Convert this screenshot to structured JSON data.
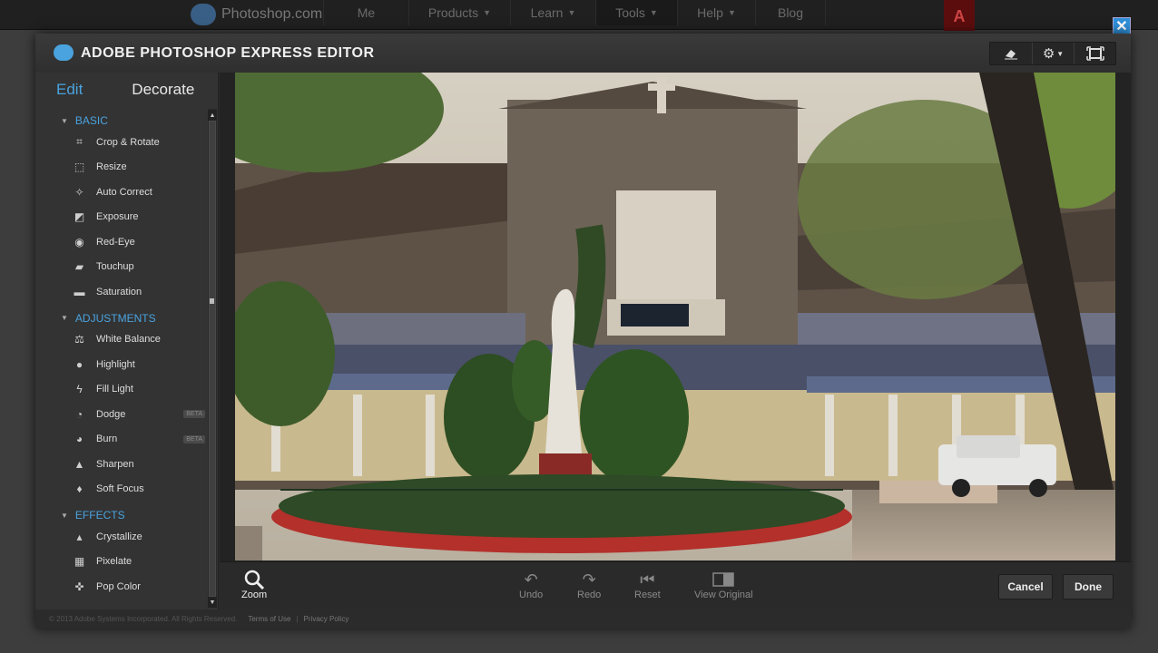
{
  "site_nav": {
    "brand": "Photoshop.com",
    "items": [
      {
        "label": "Me",
        "caret": false
      },
      {
        "label": "Products",
        "caret": true
      },
      {
        "label": "Learn",
        "caret": true
      },
      {
        "label": "Tools",
        "caret": true
      },
      {
        "label": "Help",
        "caret": true
      },
      {
        "label": "Blog",
        "caret": false
      }
    ],
    "adobe_logo": "A"
  },
  "editor": {
    "title": "ADOBE PHOTOSHOP EXPRESS EDITOR",
    "close": "✕",
    "toolbar_icons": [
      "eraser-icon",
      "gear-icon",
      "fullscreen-icon"
    ]
  },
  "sidebar": {
    "tabs": {
      "edit": "Edit",
      "decorate": "Decorate"
    },
    "sections": [
      {
        "title": "BASIC",
        "tools": [
          {
            "label": "Crop & Rotate",
            "icon": "crop-icon",
            "glyph": "⌗"
          },
          {
            "label": "Resize",
            "icon": "resize-icon",
            "glyph": "⬚"
          },
          {
            "label": "Auto Correct",
            "icon": "magic-wand-icon",
            "glyph": "✧"
          },
          {
            "label": "Exposure",
            "icon": "exposure-icon",
            "glyph": "◩"
          },
          {
            "label": "Red-Eye",
            "icon": "eye-icon",
            "glyph": "◉"
          },
          {
            "label": "Touchup",
            "icon": "bandage-icon",
            "glyph": "▰"
          },
          {
            "label": "Saturation",
            "icon": "saturation-icon",
            "glyph": "▬"
          }
        ]
      },
      {
        "title": "ADJUSTMENTS",
        "tools": [
          {
            "label": "White Balance",
            "icon": "scale-icon",
            "glyph": "⚖"
          },
          {
            "label": "Highlight",
            "icon": "bulb-icon",
            "glyph": "●"
          },
          {
            "label": "Fill Light",
            "icon": "lightning-icon",
            "glyph": "ϟ"
          },
          {
            "label": "Dodge",
            "icon": "dodge-icon",
            "glyph": "◔",
            "badge": "BETA"
          },
          {
            "label": "Burn",
            "icon": "burn-icon",
            "glyph": "◕",
            "badge": "BETA"
          },
          {
            "label": "Sharpen",
            "icon": "sharpen-icon",
            "glyph": "▲"
          },
          {
            "label": "Soft Focus",
            "icon": "droplet-icon",
            "glyph": "♦"
          }
        ]
      },
      {
        "title": "EFFECTS",
        "tools": [
          {
            "label": "Crystallize",
            "icon": "crystallize-icon",
            "glyph": "▴"
          },
          {
            "label": "Pixelate",
            "icon": "pixelate-icon",
            "glyph": "▦"
          },
          {
            "label": "Pop Color",
            "icon": "pop-color-icon",
            "glyph": "✜"
          }
        ]
      }
    ]
  },
  "bottom_toolbar": {
    "zoom": "Zoom",
    "undo": "Undo",
    "redo": "Redo",
    "reset": "Reset",
    "view_original": "View Original",
    "cancel": "Cancel",
    "done": "Done"
  },
  "footer": {
    "copyright": "© 2013 Adobe Systems Incorporated. All Rights Reserved.",
    "terms": "Terms of Use",
    "separator": "|",
    "privacy": "Privacy Policy"
  },
  "colors": {
    "accent": "#4aa3df",
    "close_button": "#2f8fd8",
    "adobe_red": "#5b0d0d"
  }
}
